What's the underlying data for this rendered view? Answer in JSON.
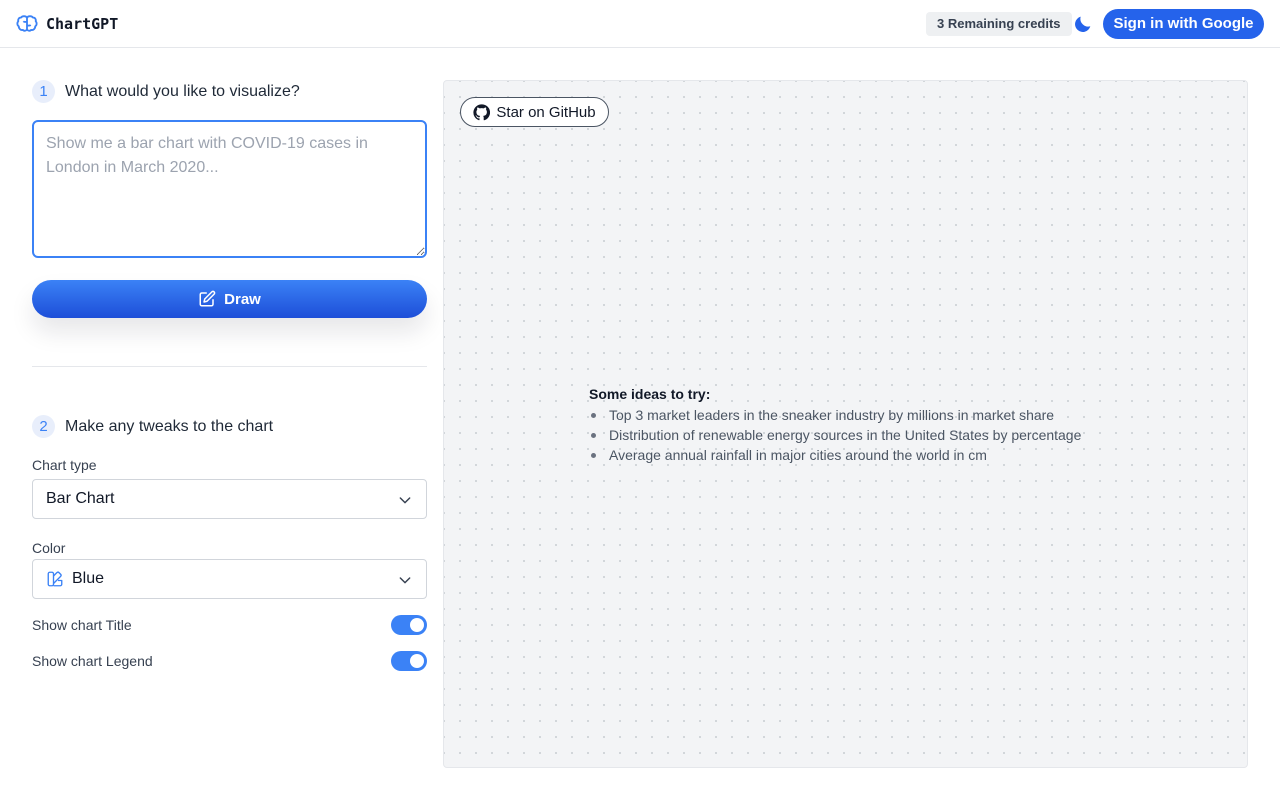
{
  "app": {
    "name": "ChartGPT",
    "logo_icon": "brain-icon"
  },
  "header": {
    "credits_label": "3 Remaining credits",
    "theme_toggle_icon": "moon-icon",
    "signin_label": "Sign in with Google"
  },
  "step1": {
    "number": "1",
    "title": "What would you like to visualize?",
    "prompt_value": "",
    "prompt_placeholder": "Show me a bar chart with COVID-19 cases in London in March 2020...",
    "draw_label": "Draw",
    "draw_icon": "pencil-square-icon"
  },
  "step2": {
    "number": "2",
    "title": "Make any tweaks to the chart",
    "chart_type_label": "Chart type",
    "chart_type_value": "Bar Chart",
    "color_label": "Color",
    "color_value": "Blue",
    "color_icon": "palette-icon",
    "toggles": [
      {
        "label": "Show chart Title",
        "on": true
      },
      {
        "label": "Show chart Legend",
        "on": true
      }
    ]
  },
  "canvas": {
    "github_label": "Star on GitHub",
    "github_icon": "github-icon",
    "ideas_title": "Some ideas to try:",
    "ideas": [
      "Top 3 market leaders in the sneaker industry by millions in market share",
      "Distribution of renewable energy sources in the United States by percentage",
      "Average annual rainfall in major cities around the world in cm"
    ]
  },
  "colors": {
    "accent": "#2563eb",
    "accent_light": "#3b82f6",
    "canvas_bg": "#f3f4f6"
  }
}
